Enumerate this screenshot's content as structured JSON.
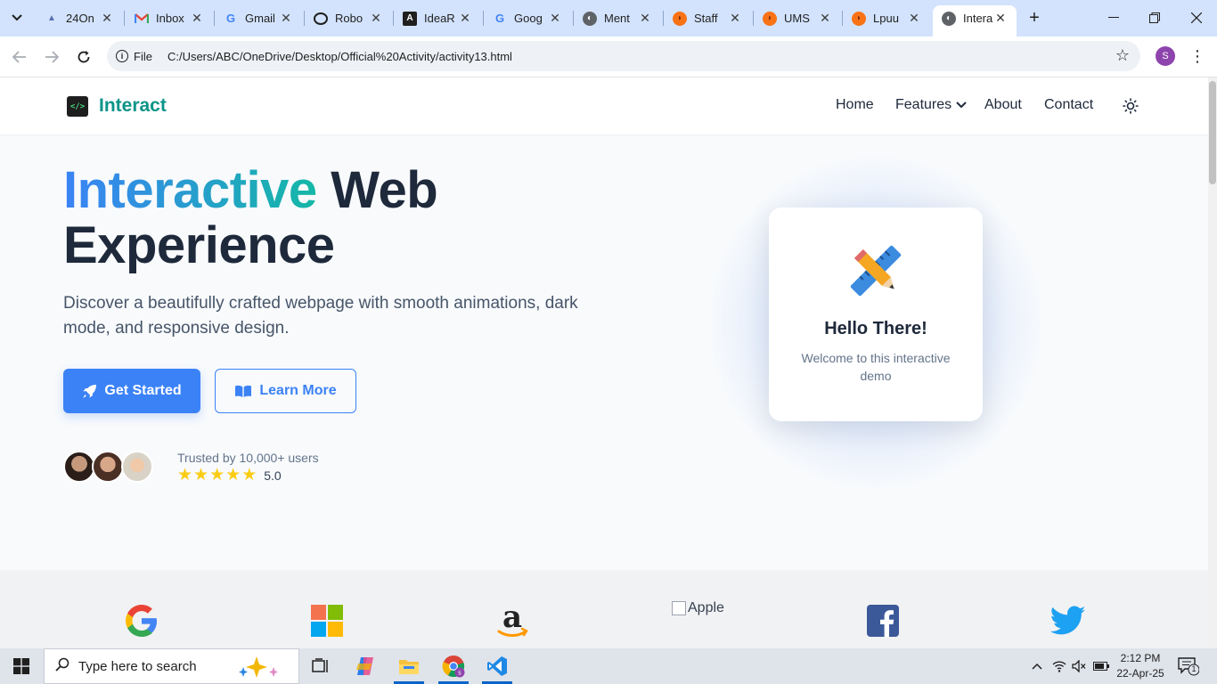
{
  "browser": {
    "tabs": [
      {
        "title": "24On",
        "icon": "tab-favicon-generic"
      },
      {
        "title": "Inbox",
        "icon": "gmail-icon"
      },
      {
        "title": "Gmail",
        "icon": "google-icon"
      },
      {
        "title": "Robo",
        "icon": "openai-icon"
      },
      {
        "title": "IdeaR",
        "icon": "angular-icon"
      },
      {
        "title": "Goog",
        "icon": "google-icon"
      },
      {
        "title": "Ment",
        "icon": "globe-icon"
      },
      {
        "title": "Staff",
        "icon": "lpu-icon"
      },
      {
        "title": "UMS",
        "icon": "lpu-icon"
      },
      {
        "title": "Lpuu",
        "icon": "lpu-icon"
      },
      {
        "title": "Intera",
        "icon": "globe-icon",
        "active": true
      }
    ],
    "address": {
      "scheme_label": "File",
      "url": "C:/Users/ABC/OneDrive/Desktop/Official%20Activity/activity13.html"
    },
    "profile_initial": "S"
  },
  "site": {
    "brand": "Interact",
    "logo_glyph": "</>",
    "nav": [
      "Home",
      "Features",
      "About",
      "Contact"
    ],
    "hero": {
      "title_highlight": "Interactive",
      "title_line1_rest": " Web",
      "title_line2": "Experience",
      "subtitle": "Discover a beautifully crafted webpage with smooth animations, dark mode, and responsive design.",
      "primary_button": "Get Started",
      "secondary_button": "Learn More",
      "trust_text": "Trusted by 10,000+ users",
      "rating": "5.0",
      "stars": 5
    },
    "card": {
      "title": "Hello There!",
      "text": "Welcome to this interactive demo"
    },
    "logos": [
      {
        "name": "google-logo"
      },
      {
        "name": "microsoft-logo"
      },
      {
        "name": "amazon-logo"
      },
      {
        "name": "apple-logo",
        "alt": "Apple"
      },
      {
        "name": "facebook-logo"
      },
      {
        "name": "twitter-logo"
      }
    ]
  },
  "taskbar": {
    "search_placeholder": "Type here to search",
    "time": "2:12 PM",
    "date": "22-Apr-25",
    "notification_count": "1"
  },
  "colors": {
    "accent": "#3b82f6",
    "brand_teal": "#0d9488",
    "star": "#facc15",
    "heading": "#1e293b"
  }
}
